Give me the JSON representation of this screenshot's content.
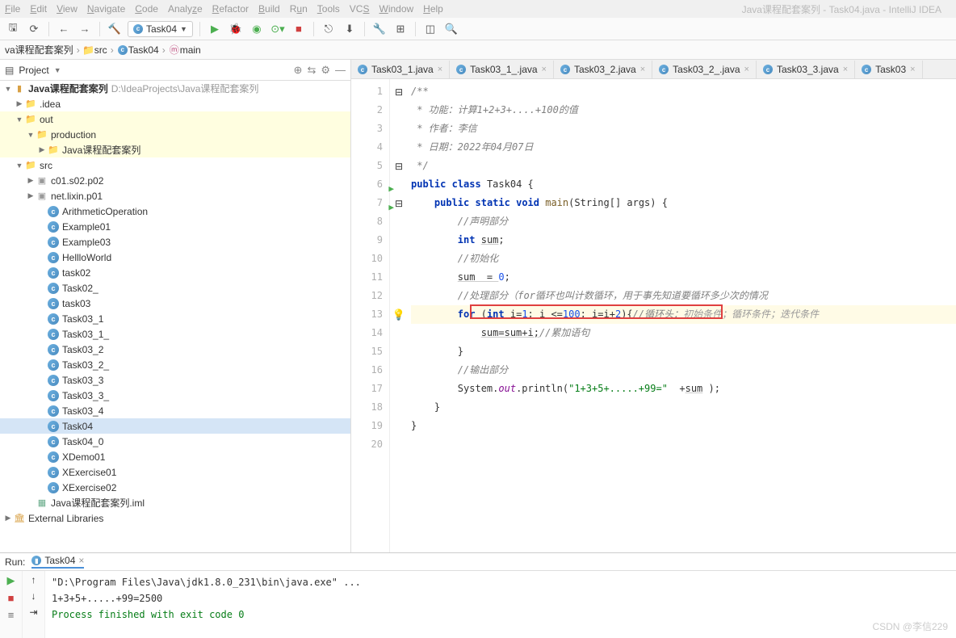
{
  "window": {
    "title": "Java课程配套案列 - Task04.java - IntelliJ IDEA"
  },
  "menu": [
    "File",
    "Edit",
    "View",
    "Navigate",
    "Code",
    "Analyze",
    "Refactor",
    "Build",
    "Run",
    "Tools",
    "VCS",
    "Window",
    "Help"
  ],
  "runConfig": "Task04",
  "breadcrumb": {
    "root": "va课程配套案列",
    "src": "src",
    "cls": "Task04",
    "method": "main"
  },
  "project": {
    "label": "Project",
    "root": {
      "name": "Java课程配套案列",
      "path": "D:\\IdeaProjects\\Java课程配套案列"
    },
    "idea": ".idea",
    "out": "out",
    "production": "production",
    "prodChild": "Java课程配套案列",
    "src": "src",
    "pkg1": "c01.s02.p02",
    "pkg2": "net.lixin.p01",
    "files": [
      "ArithmeticOperation",
      "Example01",
      "Example03",
      "HellloWorld",
      "task02",
      "Task02_",
      "task03",
      "Task03_1",
      "Task03_1_",
      "Task03_2",
      "Task03_2_",
      "Task03_3",
      "Task03_3_",
      "Task03_4",
      "Task04",
      "Task04_0",
      "XDemo01",
      "XExercise01",
      "XExercise02"
    ],
    "iml": "Java课程配套案列.iml",
    "ext": "External Libraries"
  },
  "tabs": [
    "Task03_1.java",
    "Task03_1_.java",
    "Task03_2.java",
    "Task03_2_.java",
    "Task03_3.java",
    "Task03"
  ],
  "code": {
    "c1": "/**",
    "c2": " * 功能：计算1+2+3+....+100的值",
    "c3": " * 作者：李信",
    "c4": " * 日期：2022年04月07日",
    "c5": " */",
    "kw_public": "public",
    "kw_class": "class",
    "cls": "Task04",
    "br_o": "{",
    "kw_static": "static",
    "kw_void": "void",
    "fn_main": "main",
    "args": "(String[] args) {",
    "cmt_decl": "//声明部分",
    "kw_int": "int",
    "sum": "sum",
    "cmt_init": "//初始化",
    "sum0": "sum  = ",
    "zero": "0",
    "cmt_proc": "//处理部分（for循环也叫计数循环，用于事先知道要循环多少次的情况",
    "for": "for",
    "for_line": " (",
    "kw_int2": "int",
    "for_i": " i=",
    "one": "1",
    "for_cond": "; i <=",
    "hundred": "100",
    "for_step": "; i=i+",
    "two": "2",
    "for_end": "){",
    "cmt_loophead": "//循环头：",
    "cmt_loopnote": "初始条件；循环条件；迭代条件",
    "accum": "sum=sum+i;",
    "cmt_accum": "//累加语句",
    "brace_close": "}",
    "cmt_out": "//输出部分",
    "sys": "System.",
    "out": "out",
    "print": ".println(",
    "str_out": "\"1+3+5+.....+99=\"",
    "plus": "  +",
    "sumv": "sum",
    " end": " );"
  },
  "run": {
    "label": "Run:",
    "cfg": "Task04",
    "cmd": "\"D:\\Program Files\\Java\\jdk1.8.0_231\\bin\\java.exe\" ...",
    "out": "1+3+5+.....+99=2500",
    "exit": "Process finished with exit code 0"
  },
  "watermark": "CSDN @李信229"
}
